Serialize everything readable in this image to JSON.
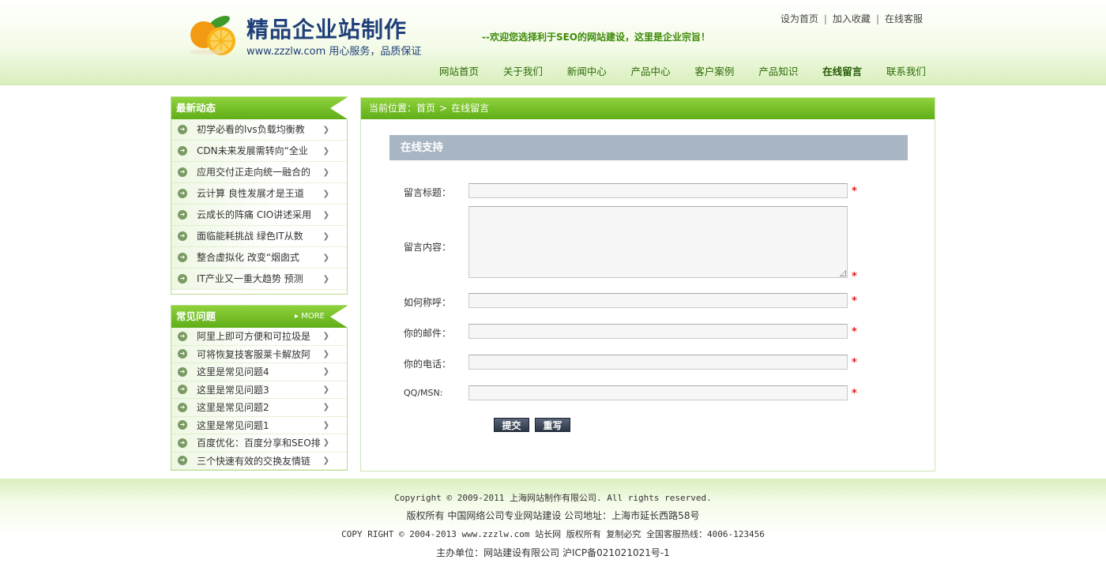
{
  "header": {
    "logo_title": "精品企业站制作",
    "logo_sub": "www.zzzlw.com 用心服务，品质保证",
    "slogan": "--欢迎您选择利于SEO的网站建设，这里是企业宗旨！",
    "toplinks": [
      "设为首页",
      "加入收藏",
      "在线客服"
    ],
    "nav": [
      "网站首页",
      "关于我们",
      "新闻中心",
      "产品中心",
      "客户案例",
      "产品知识",
      "在线留言",
      "联系我们"
    ],
    "nav_active": "在线留言"
  },
  "sidebar": {
    "news": {
      "title": "最新动态",
      "items": [
        "初学必看的lvs负载均衡教",
        "CDN未来发展需转向“全业",
        "应用交付正走向统一融合的",
        "云计算 良性发展才是王道",
        "云成长的阵痛 CIO讲述采用",
        "面临能耗挑战 绿色IT从数",
        "整合虚拟化 改变“烟囱式",
        "IT产业又一重大趋势 预测"
      ]
    },
    "faq": {
      "title": "常见问题",
      "more": "MORE",
      "items": [
        "阿里上即可方便和可拉圾是",
        "可将恢复技客服莱卡解放阿",
        "这里是常见问题4",
        "这里是常见问题3",
        "这里是常见问题2",
        "这里是常见问题1",
        "百度优化：百度分享和SEO排",
        "三个快速有效的交换友情链"
      ]
    }
  },
  "breadcrumb": {
    "prefix": "当前位置：",
    "home": "首页",
    "sep": ">",
    "current": "在线留言"
  },
  "form": {
    "section_title": "在线支持",
    "fields": {
      "title": "留言标题：",
      "content": "留言内容：",
      "name": "如何称呼：",
      "email": "你的邮件：",
      "phone": "你的电话：",
      "qq": "QQ/MSN:"
    },
    "required_mark": "*",
    "submit": "提交",
    "reset": "重写"
  },
  "footer": {
    "line1": "Copyright © 2009-2011 上海网站制作有限公司. All rights reserved.",
    "line2": "版权所有 中国网络公司专业网站建设 公司地址：上海市延长西路58号",
    "line3": "COPY RIGHT © 2004-2013 www.zzzlw.com 站长网 版权所有 复制必究 全国客服热线：4006-123456",
    "line4": "主办单位：网站建设有限公司 沪ICP备021021021号-1"
  },
  "colors": {
    "brand_green": "#5fae18",
    "nav_text": "#2c6b08",
    "section_bar": "#a8b6c4",
    "required": "#e02020"
  }
}
